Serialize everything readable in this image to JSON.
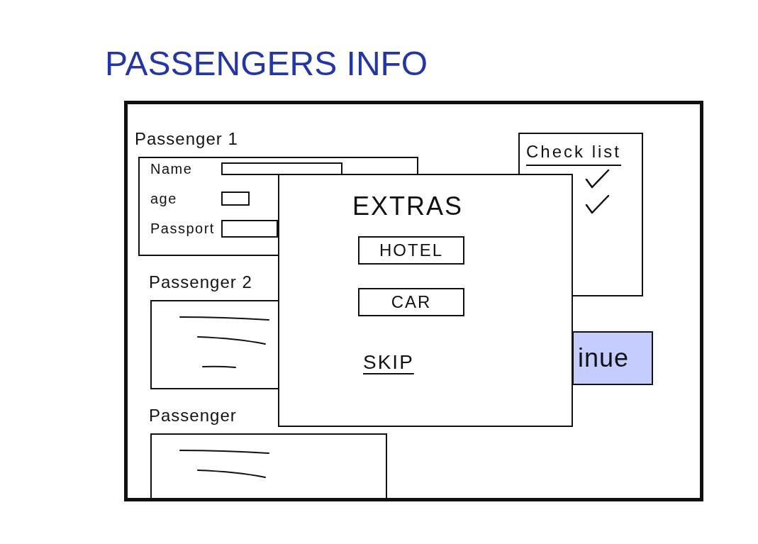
{
  "page_title": "PASSENGERS INFO",
  "passengers": [
    {
      "label": "Passenger 1",
      "kind": "form",
      "fields": [
        {
          "label": "Name"
        },
        {
          "label": "age"
        },
        {
          "label": "Passport"
        }
      ]
    },
    {
      "label": "Passenger 2",
      "kind": "lines"
    },
    {
      "label": "Passenger",
      "kind": "lines"
    }
  ],
  "checklist": {
    "title": "Check list",
    "items": [
      {
        "checked": true
      },
      {
        "checked": true
      }
    ]
  },
  "button": {
    "label": "inue"
  },
  "extras_dialog": {
    "title": "EXTRAS",
    "options": [
      {
        "label": "HOTEL"
      },
      {
        "label": "CAR"
      }
    ],
    "skip_link": "SKIP"
  }
}
